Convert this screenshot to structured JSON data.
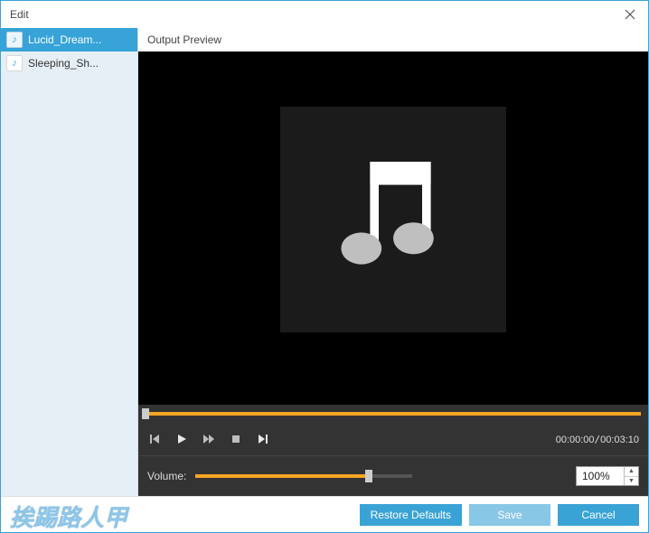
{
  "window": {
    "title": "Edit"
  },
  "sidebar": {
    "items": [
      {
        "label": "Lucid_Dream...",
        "selected": true
      },
      {
        "label": "Sleeping_Sh...",
        "selected": false
      }
    ]
  },
  "main": {
    "header": "Output Preview"
  },
  "playbar": {
    "current_time": "00:00:00",
    "total_time": "00:03:10",
    "seek_percent": 0
  },
  "volume": {
    "label": "Volume:",
    "percent": 80,
    "input_value": "100%"
  },
  "footer": {
    "restore": "Restore Defaults",
    "save": "Save",
    "cancel": "Cancel"
  },
  "watermark": "挨踢路人甲",
  "colors": {
    "accent": "#37a3d9",
    "slider": "#f5a623"
  }
}
